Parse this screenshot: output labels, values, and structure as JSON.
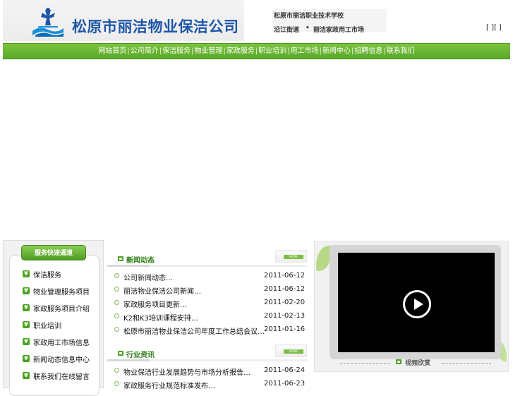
{
  "header": {
    "company_name": "松原市丽洁物业保洁公司",
    "links": {
      "school": "松原市丽洁职业技术学校",
      "street": "沿江街道",
      "separator": "•",
      "market": "丽洁家政用工市场"
    },
    "bracket_links": "[ ][ ]"
  },
  "nav": {
    "items": [
      "网站首页",
      "公司简介",
      "保洁服务",
      "物业管理",
      "家政服务",
      "职业培训",
      "用工市场",
      "新闻中心",
      "招聘信息",
      "联系我们"
    ],
    "separator": "|"
  },
  "sidebar": {
    "header": "服务快速通道",
    "items": [
      "保洁服务",
      "物业管理服务项目",
      "家政服务项目介绍",
      "职业培训",
      "家政用工市场信息",
      "新闻动态信息中心",
      "联系我们在线留言"
    ]
  },
  "news_sections": [
    {
      "title": "新闻动态",
      "more": "MORE",
      "items": [
        {
          "title": "公司新闻动态…",
          "date": "2011-06-12"
        },
        {
          "title": "丽洁物业保洁公司新闻…",
          "date": "2011-06-12"
        },
        {
          "title": "家政服务项目更新…",
          "date": "2011-02-20"
        },
        {
          "title": "K2和K3培训课程安排…",
          "date": "2011-02-13"
        },
        {
          "title": "松原市丽洁物业保洁公司年度工作总结会议…",
          "date": "2011-01-16"
        }
      ]
    },
    {
      "title": "行业资讯",
      "more": "MORE",
      "items": [
        {
          "title": "物业保洁行业发展趋势与市场分析报告…",
          "date": "2011-06-24"
        },
        {
          "title": "家政服务行业规范标准发布…",
          "date": "2011-06-23"
        }
      ]
    }
  ],
  "video": {
    "caption": "视频欣赏"
  },
  "colors": {
    "nav_green": "#5aa92b",
    "brand_blue": "#1d56a8",
    "accent_green": "#4aa320"
  }
}
